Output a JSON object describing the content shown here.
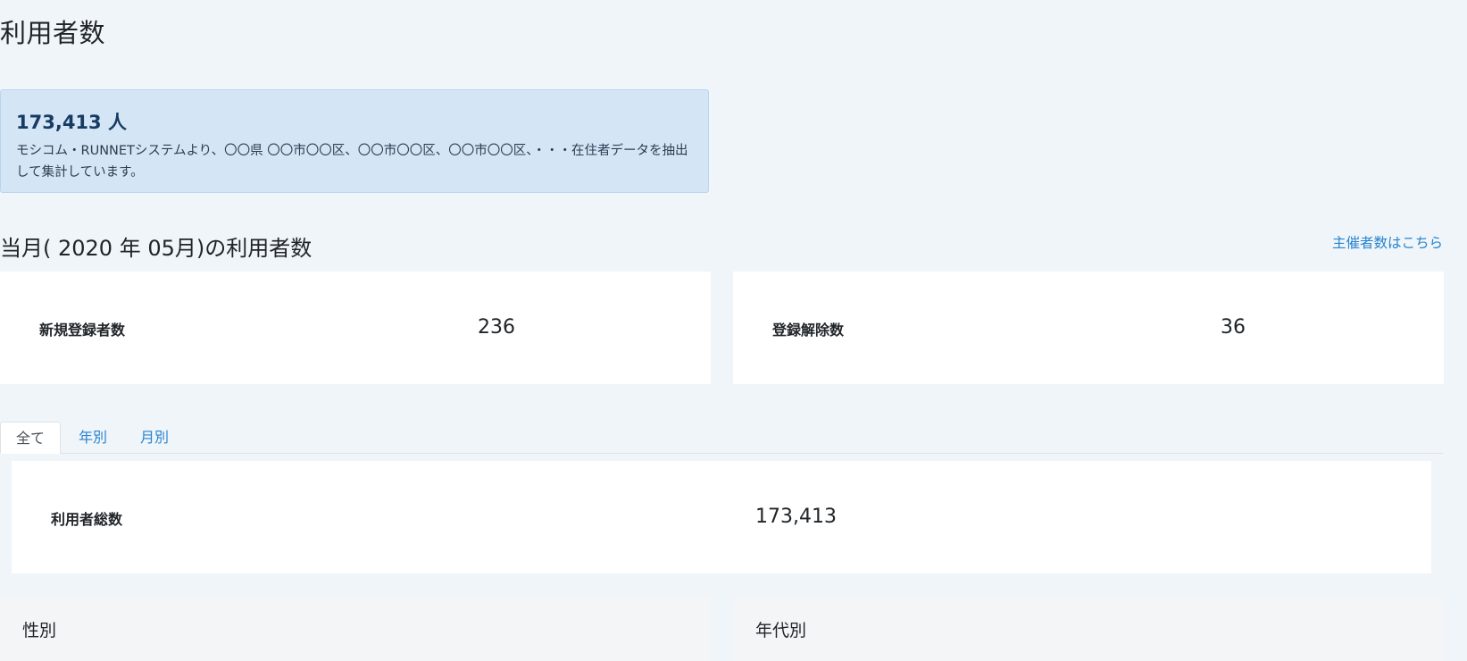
{
  "page": {
    "title": "利用者数"
  },
  "summary": {
    "count": "173,413 人",
    "description": "モシコム・RUNNETシステムより、〇〇県 〇〇市〇〇区、〇〇市〇〇区、〇〇市〇〇区、・・・在住者データを抽出して集計しています。"
  },
  "current_month": {
    "title": "当月( 2020 年 05月)の利用者数",
    "organizer_link": "主催者数はこちら",
    "new_registrations": {
      "label": "新規登録者数",
      "value": "236"
    },
    "cancellations": {
      "label": "登録解除数",
      "value": "36"
    }
  },
  "tabs": [
    {
      "label": "全て",
      "active": true
    },
    {
      "label": "年別",
      "active": false
    },
    {
      "label": "月別",
      "active": false
    }
  ],
  "total": {
    "label": "利用者総数",
    "value": "173,413"
  },
  "panels": {
    "gender": {
      "title": "性別"
    },
    "age": {
      "title": "年代別"
    }
  }
}
